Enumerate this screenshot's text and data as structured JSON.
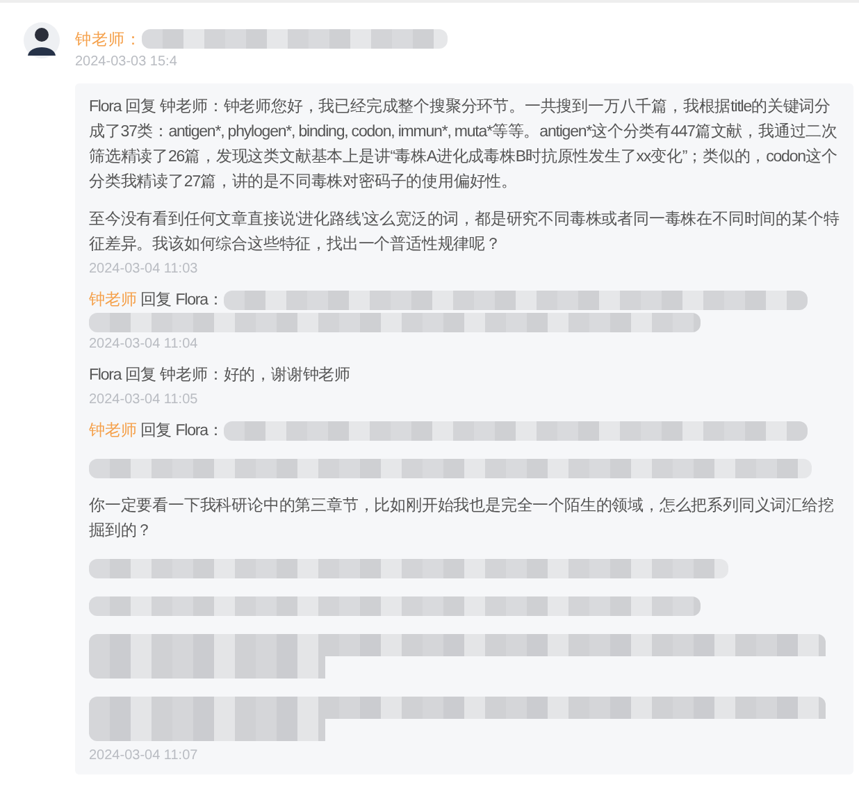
{
  "comment": {
    "author": "钟老师",
    "highlight": true,
    "colon": "：",
    "body": {
      "kind": "redacted"
    },
    "time": "2024-03-03 15:4"
  },
  "replies": [
    {
      "author": "Flora",
      "highlight": false,
      "verb": "回复",
      "target": "钟老师",
      "colon": "：",
      "body": [
        {
          "kind": "text",
          "text": "钟老师您好，我已经完成整个搜聚分环节。一共搜到一万八千篇，我根据title的关键词分成了37类：antigen*, phylogen*, binding, codon, immun*, muta*等等。antigen*这个分类有447篇文献，我通过二次筛选精读了26篇，发现这类文献基本上是讲“毒株A进化成毒株B时抗原性发生了xx变化”；类似的，codon这个分类我精读了27篇，讲的是不同毒株对密码子的使用偏好性。"
        },
        {
          "kind": "text",
          "text": "至今没有看到任何文章直接说‘进化路线’这么宽泛的词，都是研究不同毒株或者同一毒株在不同时间的某个特征差异。我该如何综合这些特征，找出一个普适性规律呢？",
          "gap": true
        }
      ],
      "time": "2024-03-04 11:03"
    },
    {
      "author": "钟老师",
      "highlight": true,
      "verb": "回复",
      "target": "Flora",
      "colon": "：",
      "body": [
        {
          "kind": "redacted_pair"
        }
      ],
      "time": "2024-03-04 11:04"
    },
    {
      "author": "Flora",
      "highlight": false,
      "verb": "回复",
      "target": "钟老师",
      "colon": "：",
      "body": [
        {
          "kind": "text",
          "text": "好的，谢谢钟老师"
        }
      ],
      "time": "2024-03-04 11:05"
    },
    {
      "author": "钟老师",
      "highlight": true,
      "verb": "回复",
      "target": "Flora",
      "colon": "：",
      "body": [
        {
          "kind": "redacted"
        },
        {
          "kind": "redacted",
          "gap": true
        },
        {
          "kind": "text",
          "text": "你一定要看一下我科研论中的第三章节，比如刚开始我也是完全一个陌生的领域，怎么把系列同义词汇给挖掘到的？",
          "gap": true
        },
        {
          "kind": "redacted",
          "gap": true
        },
        {
          "kind": "redacted",
          "gap": true
        },
        {
          "kind": "redacted_pair",
          "gap": true
        },
        {
          "kind": "redacted_pair",
          "gap": true
        }
      ],
      "time": "2024-03-04 11:07"
    }
  ]
}
